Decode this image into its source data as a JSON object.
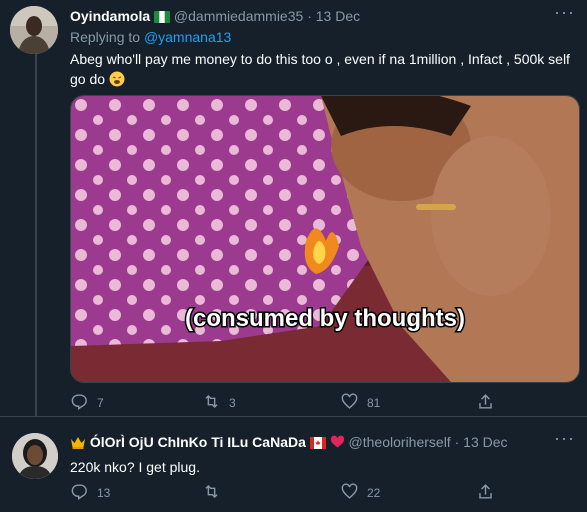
{
  "tweet1": {
    "name": "Oyindamola",
    "handle": "@dammiedammie35",
    "sep": "·",
    "date": "13 Dec",
    "more": "···",
    "replying_prefix": "Replying to ",
    "replying_to": "@yamnana13",
    "text": "Abeg who'll pay me money to do this too o , even if na 1million , Infact , 500k self go do",
    "media_caption": "(consumed by thoughts)",
    "reply_count": "7",
    "retweet_count": "3",
    "like_count": "81",
    "icons": [
      "nigeria-flag-icon",
      "weary-face-icon",
      "reply-icon",
      "retweet-icon",
      "like-icon",
      "share-icon"
    ]
  },
  "tweet2": {
    "name": "ÓlOrÌ OjU ChInKo Ti ILu CaNaDa",
    "handle": "@theoloriherself",
    "sep": "·",
    "date": "13 Dec",
    "more": "···",
    "text": "220k nko? I get plug.",
    "reply_count": "13",
    "retweet_count": "",
    "like_count": "22",
    "icons": [
      "crown-icon",
      "canada-flag-icon",
      "heart-icon",
      "reply-icon",
      "retweet-icon",
      "like-icon",
      "share-icon"
    ]
  },
  "colors": {
    "background": "#15202b",
    "muted": "#8899a6",
    "link": "#1da1f2",
    "border": "#38444d"
  }
}
